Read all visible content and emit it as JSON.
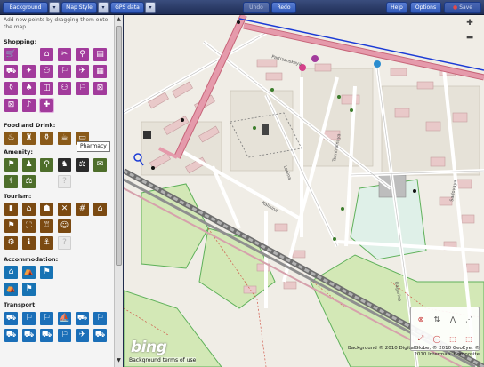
{
  "toolbar": {
    "background_label": "Background",
    "map_style_label": "Map Style",
    "gps_data_label": "GPS data",
    "undo_label": "Undo",
    "redo_label": "Redo",
    "help_label": "Help",
    "options_label": "Options",
    "save_label": "Save",
    "dropdown_glyph": "▾"
  },
  "sidebar": {
    "instructions": "Add new points by dragging them onto the map",
    "categories": {
      "shopping": "Shopping:",
      "food": "Food and Drink:",
      "amenity": "Amenity:",
      "tourism": "Tourism:",
      "accommodation": "Accommodation:",
      "transport": "Transport"
    },
    "tooltip": "Pharmacy"
  },
  "icons": {
    "shopping": [
      "⌂",
      "🛒",
      "⌂",
      "✂",
      "⚲",
      "▤",
      "⛟",
      "✦",
      "⚇",
      "⚐",
      "✈",
      "▦",
      "⚱",
      "♠",
      "◫",
      "⚇",
      "⚐",
      "⊠",
      "♪",
      "✚"
    ],
    "food": [
      "♨",
      "♜",
      "⚱",
      "☕",
      "▭"
    ],
    "amenity": [
      "⚑",
      "♟",
      "⚲",
      "♞",
      "⚖",
      "✉",
      "⚕",
      "⚖",
      "?"
    ],
    "tourism": [
      "▮",
      "⌂",
      "☗",
      "✕",
      "#",
      "⌂",
      "⚑",
      "⛶",
      "♖",
      "☺",
      "⚙",
      "ℹ",
      "⚓",
      "?"
    ],
    "accommodation": [
      "⌂",
      "⛺",
      "⚑",
      "⛺",
      "⚑"
    ],
    "transport": [
      "⛟",
      "⚐",
      "⚐",
      "⛵",
      "⛟",
      "⚐",
      "⛟",
      "⛟",
      "⛟",
      "⚐",
      "✈",
      "⛟"
    ]
  },
  "map": {
    "bing_label": "bing",
    "background_terms": "Background terms of use",
    "copyright": "Background © 2010 DigitalGlobe, © 2010 GeoEye, © 2010 Intermap, Composite",
    "street_labels": [
      "Partizanskaya",
      "Tsentralnaya",
      "Lenina",
      "Kalinina",
      "Gagarina",
      "Sadovaya"
    ]
  },
  "colors": {
    "toolbar": "#2a3a66",
    "button": "#3d65c4",
    "sidebar": "#f4f4f4",
    "map_bg": "#f0ede6",
    "road_major": "#e28b9f",
    "railway": "#7c7c7c",
    "park": "#d3e8b6",
    "building": "#e9c9c9",
    "selection": "#1b3bd6"
  }
}
